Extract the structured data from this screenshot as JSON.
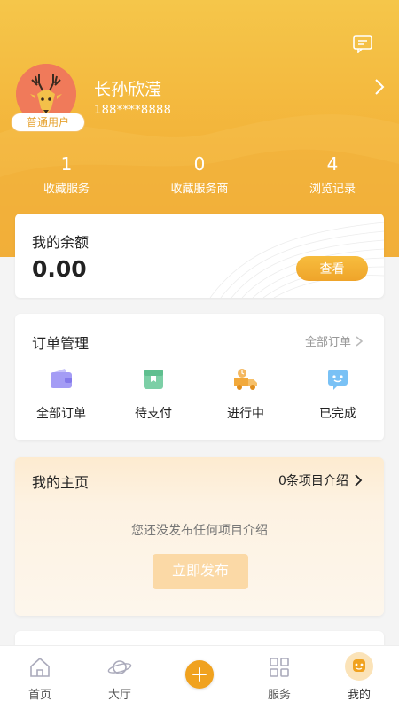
{
  "profile": {
    "name": "长孙欣滢",
    "phone": "188****8888",
    "badge": "普通用户"
  },
  "stats": [
    {
      "value": "1",
      "label": "收藏服务"
    },
    {
      "value": "0",
      "label": "收藏服务商"
    },
    {
      "value": "4",
      "label": "浏览记录"
    }
  ],
  "balance": {
    "title": "我的余额",
    "amount": "0.00",
    "view_label": "查看"
  },
  "orders": {
    "title": "订单管理",
    "all_link": "全部订单",
    "items": [
      {
        "label": "全部订单",
        "icon": "wallet-icon"
      },
      {
        "label": "待支付",
        "icon": "pending-payment-icon"
      },
      {
        "label": "进行中",
        "icon": "delivery-truck-icon"
      },
      {
        "label": "已完成",
        "icon": "completed-chat-icon"
      }
    ]
  },
  "homepage": {
    "title": "我的主页",
    "count_label": "0条项目介绍",
    "empty_text": "您还没发布任何项目介绍",
    "publish_label": "立即发布"
  },
  "tabbar": {
    "items": [
      {
        "label": "首页",
        "icon": "home-icon"
      },
      {
        "label": "大厅",
        "icon": "planet-icon"
      },
      {
        "label": "",
        "icon": "plus-icon"
      },
      {
        "label": "服务",
        "icon": "grid-icon"
      },
      {
        "label": "我的",
        "icon": "user-icon"
      }
    ],
    "active": "我的"
  },
  "colors": {
    "accent": "#f0a21f",
    "header_top": "#f5c64a",
    "header_bottom": "#efa52e",
    "avatar_bg": "#f07a5a"
  }
}
